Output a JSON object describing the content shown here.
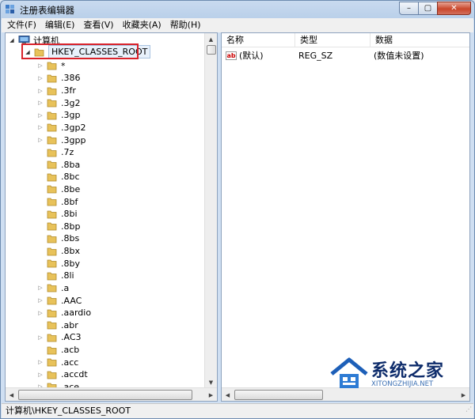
{
  "window": {
    "title": "注册表编辑器",
    "buttons": {
      "minimize": "–",
      "maximize": "▢",
      "close": "✕"
    }
  },
  "menu": [
    "文件(F)",
    "编辑(E)",
    "查看(V)",
    "收藏夹(A)",
    "帮助(H)"
  ],
  "tree": {
    "computer_label": "计算机",
    "root_label": "HKEY_CLASSES_ROOT",
    "items": [
      {
        "label": "*",
        "expandable": true
      },
      {
        "label": ".386",
        "expandable": true
      },
      {
        "label": ".3fr",
        "expandable": true
      },
      {
        "label": ".3g2",
        "expandable": true
      },
      {
        "label": ".3gp",
        "expandable": true
      },
      {
        "label": ".3gp2",
        "expandable": true
      },
      {
        "label": ".3gpp",
        "expandable": true
      },
      {
        "label": ".7z",
        "expandable": false
      },
      {
        "label": ".8ba",
        "expandable": false
      },
      {
        "label": ".8bc",
        "expandable": false
      },
      {
        "label": ".8be",
        "expandable": false
      },
      {
        "label": ".8bf",
        "expandable": false
      },
      {
        "label": ".8bi",
        "expandable": false
      },
      {
        "label": ".8bp",
        "expandable": false
      },
      {
        "label": ".8bs",
        "expandable": false
      },
      {
        "label": ".8bx",
        "expandable": false
      },
      {
        "label": ".8by",
        "expandable": false
      },
      {
        "label": ".8li",
        "expandable": false
      },
      {
        "label": ".a",
        "expandable": true
      },
      {
        "label": ".AAC",
        "expandable": true
      },
      {
        "label": ".aardio",
        "expandable": true
      },
      {
        "label": ".abr",
        "expandable": false
      },
      {
        "label": ".AC3",
        "expandable": true
      },
      {
        "label": ".acb",
        "expandable": false
      },
      {
        "label": ".acc",
        "expandable": true
      },
      {
        "label": ".accdt",
        "expandable": true
      },
      {
        "label": ".ace",
        "expandable": true
      }
    ]
  },
  "values": {
    "headers": {
      "name": "名称",
      "type": "类型",
      "data": "数据"
    },
    "rows": [
      {
        "name": "(默认)",
        "type": "REG_SZ",
        "data": "(数值未设置)"
      }
    ]
  },
  "status_path": "计算机\\HKEY_CLASSES_ROOT",
  "watermark": {
    "brand": "系统之家",
    "url": "XITONGZHIJIA.NET"
  },
  "colors": {
    "highlight_border": "#d9222a",
    "folder": "#e8c25a"
  }
}
